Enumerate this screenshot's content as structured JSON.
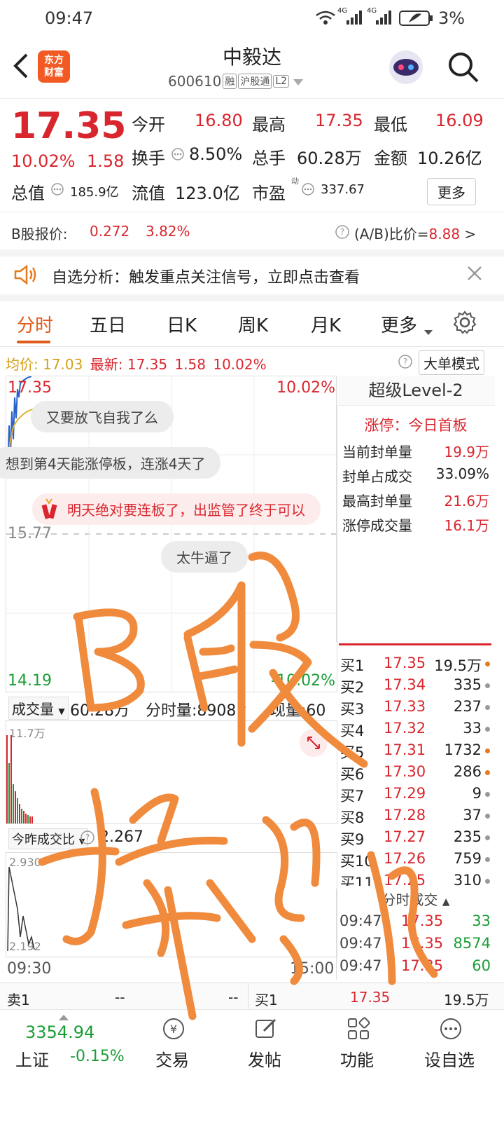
{
  "status_bar": {
    "time": "09:47",
    "signal1": "4G",
    "signal2": "4G",
    "battery": "3%"
  },
  "header": {
    "logo_line1": "东方",
    "logo_line2": "财富",
    "title": "中毅达",
    "code": "600610",
    "tags": [
      "融",
      "沪股通",
      "L2"
    ]
  },
  "quote": {
    "price": "17.35",
    "change_pct": "10.02%",
    "change": "1.58",
    "open_label": "今开",
    "open": "16.80",
    "high_label": "最高",
    "high": "17.35",
    "low_label": "最低",
    "low": "16.09",
    "turnover_label": "换手",
    "turnover": "8.50%",
    "volume_label": "总手",
    "volume": "60.28万",
    "amount_label": "金额",
    "amount": "10.26亿",
    "mktcap_label": "总值",
    "mktcap": "185.9亿",
    "float_label": "流值",
    "float": "123.0亿",
    "pe_label": "市盈",
    "pe_sup": "动",
    "pe": "337.67",
    "more_button": "更多"
  },
  "b_share": {
    "label": "B股报价:",
    "price": "0.272",
    "pct": "3.82%",
    "ratio_label": "(A/B)比价=",
    "ratio": "8.88",
    "arrow": ">"
  },
  "notice": {
    "text": "自选分析：触发重点关注信号，立即点击查看"
  },
  "tabs": [
    "分时",
    "五日",
    "日K",
    "周K",
    "月K",
    "更多"
  ],
  "chart_info": {
    "avg_label": "均价:",
    "avg": "17.03",
    "latest_label": "最新:",
    "latest": "17.35",
    "change": "1.58",
    "pct": "10.02%",
    "big_order_button": "大单模式"
  },
  "chart": {
    "top_price": "17.35",
    "top_pct": "10.02%",
    "mid_price": "15.77",
    "bottom_price": "14.19",
    "bottom_pct": "-10.02%",
    "comments": [
      "又要放飞自我了么",
      "想到第4天能涨停板，连涨4天了",
      "明天绝对要连板了，出监管了终于可以",
      "太牛逼了"
    ],
    "volume_selector": "成交量",
    "volume_total": "60.28万",
    "minute_volume": "分时量:8908↑",
    "current_volume": "现量:60",
    "volume_max": "11.7万",
    "ratio_selector": "今昨成交比",
    "ratio_value": "2.267",
    "ratio_top": "2.930",
    "ratio_bottom": "2.192",
    "time_start": "09:30",
    "time_end": "15:00"
  },
  "level2": {
    "title": "超级Level-2",
    "limit_label": "涨停：今日首板",
    "rows": [
      {
        "label": "当前封单量",
        "value": "19.9万"
      },
      {
        "label": "封单占成交",
        "value": "33.09%"
      },
      {
        "label": "最高封单量",
        "value": "21.6万"
      },
      {
        "label": "涨停成交量",
        "value": "16.1万"
      }
    ]
  },
  "order_book": [
    {
      "label": "买1",
      "price": "17.35",
      "volume": "19.5万",
      "dot": "#e67a1e"
    },
    {
      "label": "买2",
      "price": "17.34",
      "volume": "335",
      "dot": "#999999"
    },
    {
      "label": "买3",
      "price": "17.33",
      "volume": "237",
      "dot": "#999999"
    },
    {
      "label": "买4",
      "price": "17.32",
      "volume": "33",
      "dot": "#999999"
    },
    {
      "label": "买5",
      "price": "17.31",
      "volume": "1732",
      "dot": "#e67a1e"
    },
    {
      "label": "买6",
      "price": "17.30",
      "volume": "286",
      "dot": "#e67a1e"
    },
    {
      "label": "买7",
      "price": "17.29",
      "volume": "9",
      "dot": "#999999"
    },
    {
      "label": "买8",
      "price": "17.28",
      "volume": "37",
      "dot": "#999999"
    },
    {
      "label": "买9",
      "price": "17.27",
      "volume": "235",
      "dot": "#999999"
    },
    {
      "label": "买10",
      "price": "17.26",
      "volume": "759",
      "dot": "#999999"
    },
    {
      "label": "买11",
      "price": "17.25",
      "volume": "310",
      "dot": "#999999"
    }
  ],
  "trades": {
    "title": "分时成交",
    "rows": [
      {
        "time": "09:47",
        "price": "17.35",
        "volume": "33"
      },
      {
        "time": "09:47",
        "price": "17.35",
        "volume": "8574"
      },
      {
        "time": "09:47",
        "price": "17.35",
        "volume": "60"
      }
    ]
  },
  "bid_ask": {
    "sell_label": "卖1",
    "sell_price": "--",
    "sell_vol": "--",
    "buy_label": "买1",
    "buy_price": "17.35",
    "buy_vol": "19.5万"
  },
  "bottom_nav": {
    "index_value": "3354.94",
    "index_name": "上证",
    "index_pct": "-0.15%",
    "items": [
      "交易",
      "发帖",
      "功能",
      "设自选"
    ]
  },
  "handwriting": {
    "line1": "B股",
    "line2": "操纵"
  },
  "colors": {
    "up": "#d9262e",
    "down": "#1b9d36",
    "accent": "#e05a1a",
    "handwriting": "#f08a3c"
  }
}
